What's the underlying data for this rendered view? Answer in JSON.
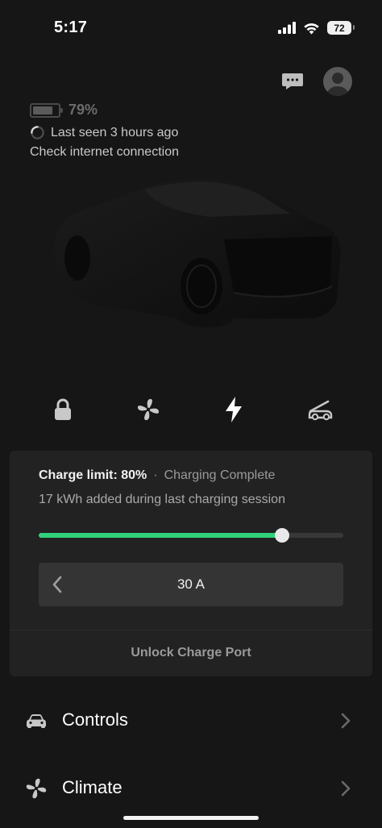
{
  "status_bar": {
    "time": "5:17",
    "battery_level": "72"
  },
  "vehicle": {
    "battery_percent": "79%",
    "battery_fraction": 0.79,
    "last_seen": "Last seen 3 hours ago",
    "connection_message": "Check internet connection"
  },
  "quick_actions": [
    {
      "icon": "lock-icon"
    },
    {
      "icon": "fan-icon"
    },
    {
      "icon": "bolt-icon"
    },
    {
      "icon": "frunk-icon"
    }
  ],
  "charging": {
    "limit_label": "Charge limit: 80%",
    "separator": "·",
    "state": "Charging Complete",
    "session_info": "17 kWh added during last charging session",
    "limit_fraction": 0.8,
    "current_amps": "30 A",
    "unlock_port_label": "Unlock Charge Port"
  },
  "menu": [
    {
      "label": "Controls",
      "icon": "car-icon"
    },
    {
      "label": "Climate",
      "icon": "fan-icon"
    }
  ],
  "colors": {
    "background": "#161616",
    "card": "#222222",
    "accent_green": "#2fd17a"
  }
}
